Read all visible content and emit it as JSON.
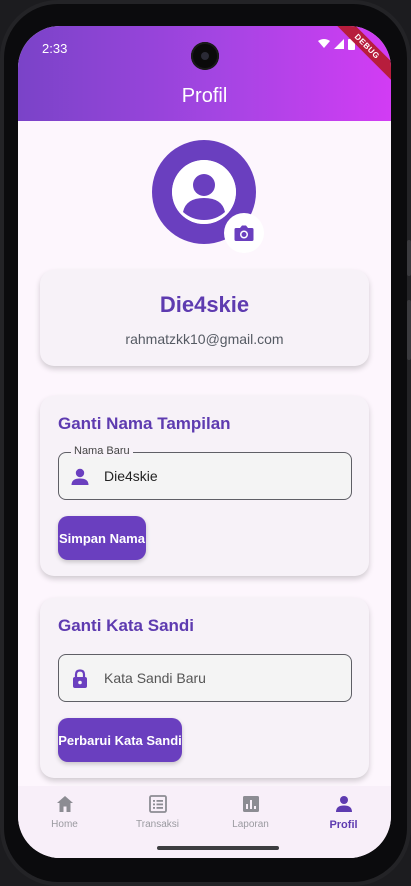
{
  "status_bar": {
    "time": "2:33",
    "debug_banner": "DEBUG"
  },
  "appbar": {
    "title": "Profil"
  },
  "profile": {
    "username": "Die4skie",
    "email": "rahmatzkk10@gmail.com"
  },
  "change_name": {
    "title": "Ganti Nama Tampilan",
    "field_label": "Nama Baru",
    "field_value": "Die4skie",
    "button_label": "Simpan Nama"
  },
  "change_password": {
    "title": "Ganti Kata Sandi",
    "field_placeholder": "Kata Sandi Baru",
    "button_label": "Perbarui Kata Sandi"
  },
  "nav": {
    "items": [
      {
        "label": "Home",
        "icon": "home-icon"
      },
      {
        "label": "Transaksi",
        "icon": "receipt-icon"
      },
      {
        "label": "Laporan",
        "icon": "chart-icon"
      },
      {
        "label": "Profil",
        "icon": "person-icon"
      }
    ],
    "active_index": 3
  },
  "colors": {
    "primary": "#6a3fbf",
    "gradient_start": "#7a43c8",
    "gradient_end": "#d23cf4",
    "background": "#fdf6fd"
  }
}
